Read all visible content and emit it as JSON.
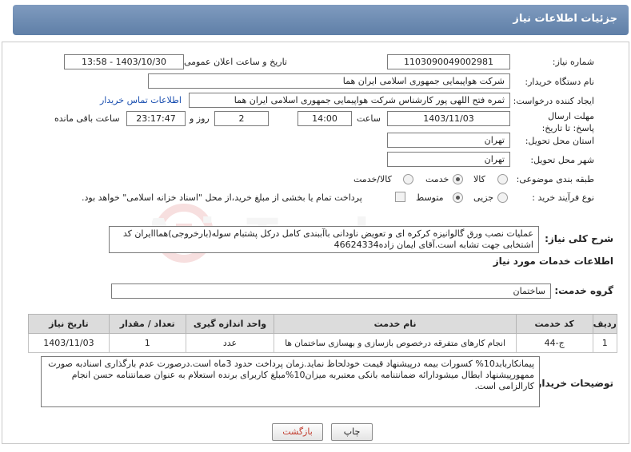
{
  "header": {
    "title": "جزئیات اطلاعات نیاز"
  },
  "form": {
    "need_number": {
      "label": "شماره نیاز:",
      "value": "1103090049002981"
    },
    "announce_datetime": {
      "label": "تاریخ و ساعت اعلان عمومی:",
      "value": "1403/10/30 - 13:58"
    },
    "buyer_org": {
      "label": "نام دستگاه خریدار:",
      "value": "شرکت هواپیمایی جمهوری اسلامی ایران هما"
    },
    "requester": {
      "label": "ایجاد کننده درخواست:",
      "value": "ثمره فتح اللهی پور کارشناس شرکت هواپیمایی جمهوری اسلامی ایران هما",
      "contact_link": "اطلاعات تماس خریدار"
    },
    "deadline": {
      "label": "مهلت ارسال پاسخ: تا تاریخ:",
      "date": "1403/11/03",
      "time_label": "ساعت",
      "time": "14:00",
      "days": "2",
      "days_label": "روز و",
      "remaining": "23:17:47",
      "remaining_label": "ساعت باقی مانده"
    },
    "delivery_province": {
      "label": "استان محل تحویل:",
      "value": "تهران"
    },
    "delivery_city": {
      "label": "شهر محل تحویل:",
      "value": "تهران"
    },
    "category": {
      "label": "طبقه بندی موضوعی:",
      "options": [
        "کالا",
        "خدمت",
        "کالا/خدمت"
      ],
      "selected": "خدمت"
    },
    "process_type": {
      "label": "نوع فرآیند خرید :",
      "options": [
        "جزیی",
        "متوسط"
      ],
      "selected": "متوسط",
      "treasury_note": "پرداخت تمام یا بخشی از مبلغ خرید،از محل \"اسناد خزانه اسلامی\" خواهد بود."
    }
  },
  "summary": {
    "label": "شرح کلی نیاز:",
    "value": "عملیات نصب ورق گالوانیزه کرکره ای و تعویض ناودانی باآببندی کامل درکل پشتبام سوله(بارخروجی)همااایران کد اشتخابی جهت تشابه است.آقای ایمان زاده46624334"
  },
  "services": {
    "section_title": "اطلاعات خدمات مورد نیاز",
    "group_label": "گروه خدمت:",
    "group_value": "ساختمان",
    "columns": [
      "ردیف",
      "کد خدمت",
      "نام خدمت",
      "واحد اندازه گیری",
      "تعداد / مقدار",
      "تاریخ نیاز"
    ],
    "rows": [
      [
        "1",
        "ج-44",
        "انجام کارهای متفرقه درخصوص بازسازی و بهسازی ساختمان ها",
        "عدد",
        "1",
        "1403/11/03"
      ]
    ]
  },
  "buyer_notes": {
    "label": "توضیحات خریدار:",
    "value": "پیمانکاربابد10% کسورات بیمه درپیشنهاد قیمت خودلحاظ نماید.زمان پرداخت حدود 3ماه است.درصورت عدم بارگذاری اسنادبه صورت ممهورپیشنهاد ابطال میشودارائه ضمانتنامه بانکی معتبربه میزان10%مبلغ کاربرای برنده استعلام به عنوان ضمانتنامه حسن انجام کارالزامی است."
  },
  "buttons": {
    "print": "چاپ",
    "back": "بازگشت"
  },
  "watermark": {
    "text": "AriaTender.neT"
  }
}
